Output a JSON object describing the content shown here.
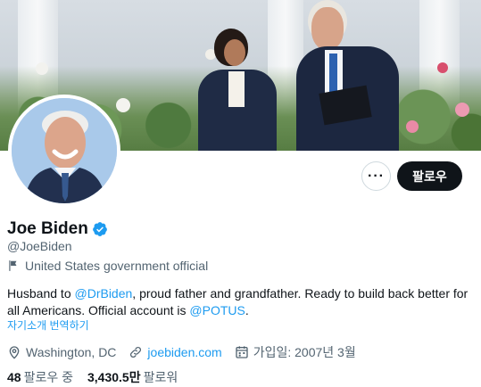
{
  "profile": {
    "name": "Joe Biden",
    "handle": "@JoeBiden",
    "label": "United States government official",
    "bio": {
      "part1": "Husband to ",
      "mention1": "@DrBiden",
      "part2": ", proud father and grandfather. Ready to build back better for all Americans. Official account is ",
      "mention2": "@POTUS",
      "part3": "."
    },
    "translate_bio": "자기소개 번역하기",
    "location": "Washington, DC",
    "website": "joebiden.com",
    "joined": "가입일: 2007년 3월"
  },
  "stats": {
    "following_count": "48",
    "following_label": "팔로우 중",
    "followers_count": "3,430.5만",
    "followers_label": "팔로워"
  },
  "actions": {
    "more_label": "···",
    "follow_label": "팔로우"
  },
  "colors": {
    "accent": "#1d9bf0",
    "text_primary": "#0f1419",
    "text_secondary": "#536471",
    "follow_button_bg": "#0f1419"
  },
  "icons": [
    "verified-badge-icon",
    "flag-icon",
    "location-pin-icon",
    "link-icon",
    "calendar-icon",
    "more-icon"
  ]
}
